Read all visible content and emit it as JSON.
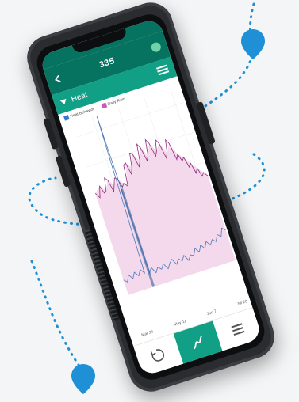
{
  "status_bar": {
    "carrier": "",
    "time": "",
    "battery": ""
  },
  "app_bar": {
    "title": "335"
  },
  "section": {
    "title": "Heat"
  },
  "legend": [
    {
      "label": "Heat Behavior",
      "color": "#3a7ac7"
    },
    {
      "label": "Daily Rum",
      "color": "#c95ab8"
    }
  ],
  "x_ticks": [
    "Mar 24",
    "May 11",
    "Jun 7",
    "Jul 28"
  ],
  "colors": {
    "primary": "#05735f",
    "accent": "#11a086",
    "heat_fill": "#f3d9eb",
    "heat_line": "#8e2c7d",
    "activity_line": "#4c78b8"
  },
  "icons": [
    "back-icon",
    "menu-icon",
    "sync-icon",
    "chart-icon",
    "list-icon"
  ]
}
